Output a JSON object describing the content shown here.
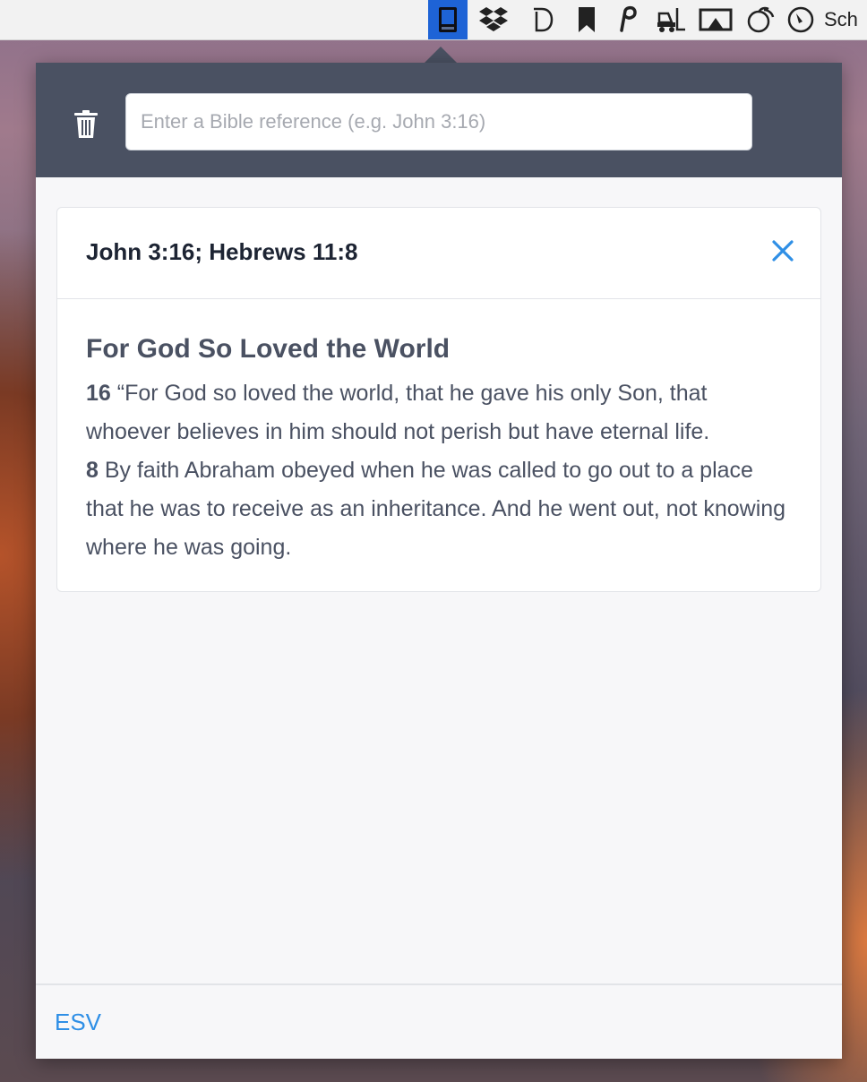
{
  "menubar": {
    "icons": [
      "bible-icon",
      "dropbox-icon",
      "d-app-icon",
      "bookmark-icon",
      "p-app-icon",
      "forklift-icon",
      "airplay-icon",
      "fruit-icon",
      "clock-icon"
    ],
    "clock_text": "Sch"
  },
  "search": {
    "placeholder": "Enter a Bible reference (e.g. John 3:16)",
    "value": ""
  },
  "result": {
    "reference": "John 3:16; Hebrews 11:8",
    "heading": "For God So Loved the World",
    "verses": [
      {
        "number": "16",
        "text": "“For God so loved the world, that he gave his only Son, that whoever believes in him should not perish but have eternal life."
      },
      {
        "number": "8",
        "text": "By faith Abraham obeyed when he was called to go out to a place that he was to receive as an inheritance. And he went out, not knowing where he was going."
      }
    ]
  },
  "footer": {
    "version": "ESV"
  },
  "colors": {
    "header_bg": "#4a5162",
    "accent": "#2f8fe6",
    "active_menubar": "#1e63d6"
  }
}
